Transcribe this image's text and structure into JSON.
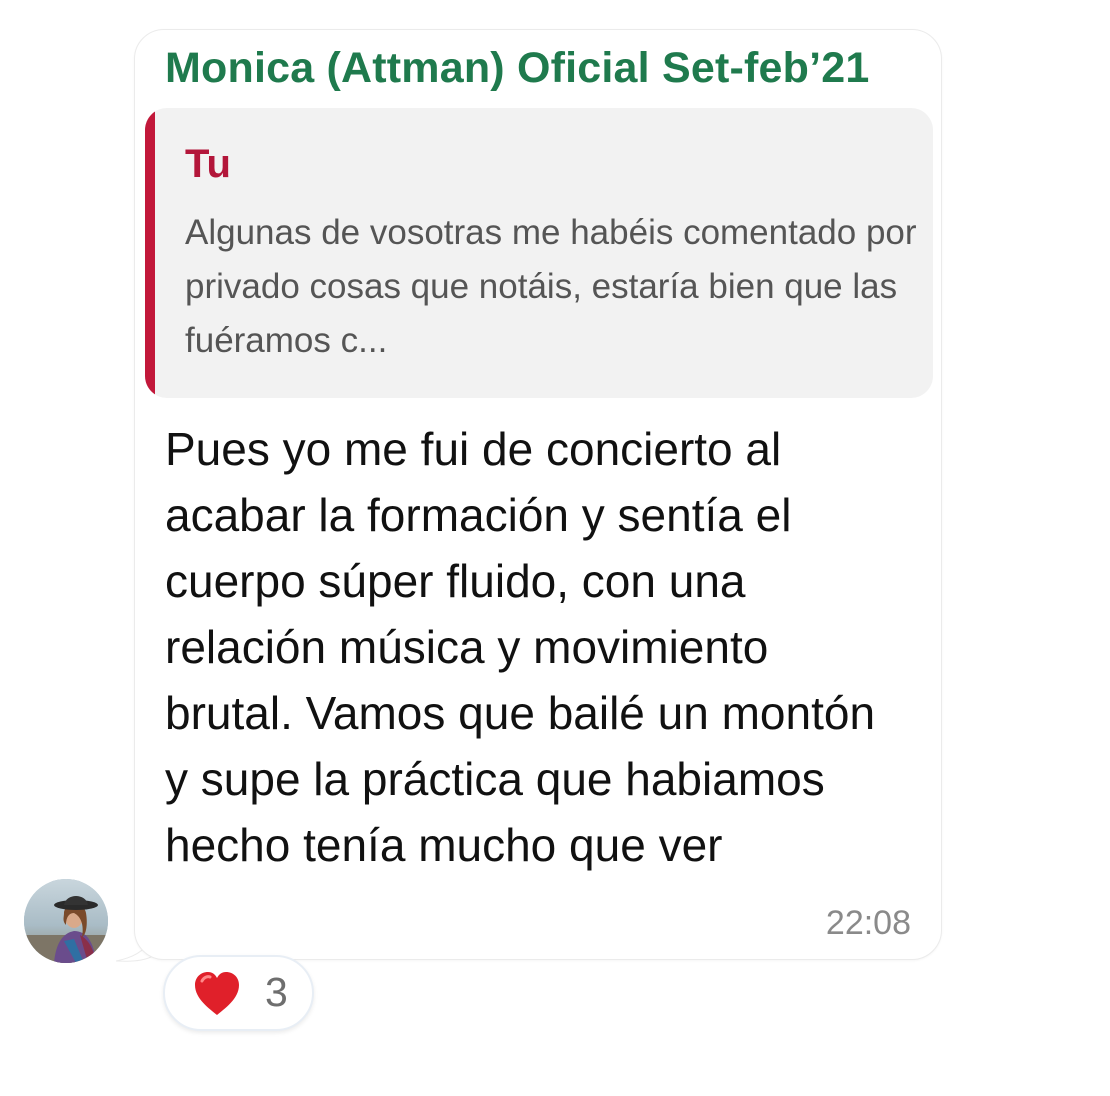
{
  "message": {
    "sender_name": "Monica (Attman) Oficial Set-feb’21",
    "quoted_reply": {
      "author": "Tu",
      "text": "Algunas de vosotras me habéis comentado por privado cosas que notáis, estaría bien que las fuéramos c..."
    },
    "body": "Pues yo me fui de concierto al acabar la formación y sentía el cuerpo súper fluido, con una relación música y movimiento brutal. Vamos que bailé un montón y supe la práctica que habiamos hecho tenía mucho que ver",
    "timestamp": "22:08",
    "reaction": {
      "icon": "heart-icon",
      "count": "3"
    }
  },
  "colors": {
    "sender": "#1f7a4d",
    "quote_bar": "#c2183a",
    "quote_author": "#b3163a",
    "quote_background": "#f2f2f2",
    "timestamp": "#8a8a8a"
  }
}
